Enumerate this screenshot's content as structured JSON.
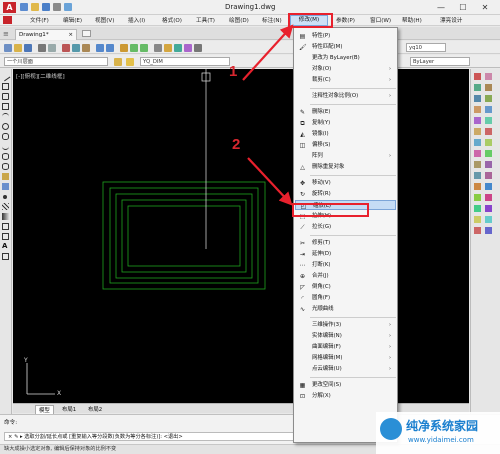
{
  "title_bar": {
    "logo_letter": "A",
    "title": "Drawing1.dwg",
    "minimize": "—",
    "maximize": "☐",
    "close": "✕"
  },
  "menu": {
    "items": [
      "文件(F)",
      "编辑(E)",
      "视图(V)",
      "插入(I)",
      "格式(O)",
      "工具(T)",
      "绘图(D)",
      "标注(N)",
      "修改(M)",
      "参数(P)",
      "窗口(W)",
      "帮助(H)",
      "漂亮设计"
    ]
  },
  "tabs": {
    "doc": "Drawing1*",
    "doc_close": "×"
  },
  "toolbar": {
    "layer_combo": "一个川层面",
    "style_combo": "YQ_DIM",
    "right_combo": "yq10",
    "bylayer": "ByLayer",
    "by_label": "ByLayer"
  },
  "viewport": {
    "label": "[-][俯视][二维线框]"
  },
  "layout_tabs": {
    "model": "模型",
    "layout1": "布局1",
    "layout2": "布局2"
  },
  "command": {
    "label": "命令:",
    "line": "× ✎ ▸ 选取分割/延长点或 [重复输入等分段数(负数为等分各标注)]: <退出>"
  },
  "status": {
    "text": "缺大成操小选定对象, 编辑后保持对象的比例不变"
  },
  "dropdown": {
    "items": [
      {
        "label": "特性(P)",
        "icon": "▤",
        "arrow": ""
      },
      {
        "label": "特性匹配(M)",
        "icon": "🖌",
        "arrow": ""
      },
      {
        "label": "更改为 ByLayer(B)",
        "icon": "",
        "arrow": ""
      },
      {
        "label": "对象(O)",
        "icon": "",
        "arrow": "›"
      },
      {
        "label": "裁剪(C)",
        "icon": "",
        "arrow": "›"
      },
      {
        "label": "注释性对象比例(O)",
        "icon": "",
        "arrow": "›"
      },
      {
        "label": "删除(E)",
        "icon": "✎",
        "arrow": ""
      },
      {
        "label": "复制(Y)",
        "icon": "⧉",
        "arrow": ""
      },
      {
        "label": "镜像(I)",
        "icon": "◭",
        "arrow": ""
      },
      {
        "label": "偏移(S)",
        "icon": "◫",
        "arrow": ""
      },
      {
        "label": "阵列",
        "icon": "",
        "arrow": "›"
      },
      {
        "label": "删除重复对象",
        "icon": "△",
        "arrow": ""
      },
      {
        "label": "移动(V)",
        "icon": "✥",
        "arrow": ""
      },
      {
        "label": "旋转(R)",
        "icon": "↻",
        "arrow": ""
      },
      {
        "label": "缩放(L)",
        "icon": "◰",
        "arrow": ""
      },
      {
        "label": "拉伸(H)",
        "icon": "⬚",
        "arrow": ""
      },
      {
        "label": "拉长(G)",
        "icon": "⟋",
        "arrow": ""
      },
      {
        "label": "修剪(T)",
        "icon": "✂",
        "arrow": ""
      },
      {
        "label": "延伸(D)",
        "icon": "⇥",
        "arrow": ""
      },
      {
        "label": "打断(K)",
        "icon": "⋯",
        "arrow": ""
      },
      {
        "label": "合并(J)",
        "icon": "⊕",
        "arrow": ""
      },
      {
        "label": "倒角(C)",
        "icon": "◸",
        "arrow": ""
      },
      {
        "label": "圆角(F)",
        "icon": "◜",
        "arrow": ""
      },
      {
        "label": "光顺曲线",
        "icon": "∿",
        "arrow": ""
      },
      {
        "label": "三维操作(3)",
        "icon": "",
        "arrow": "›"
      },
      {
        "label": "实体编辑(N)",
        "icon": "",
        "arrow": "›"
      },
      {
        "label": "曲面编辑(F)",
        "icon": "",
        "arrow": "›"
      },
      {
        "label": "网格编辑(M)",
        "icon": "",
        "arrow": "›"
      },
      {
        "label": "点云编辑(U)",
        "icon": "",
        "arrow": "›"
      },
      {
        "label": "更改空间(S)",
        "icon": "▦",
        "arrow": ""
      },
      {
        "label": "分解(X)",
        "icon": "⊡",
        "arrow": ""
      }
    ]
  },
  "annotations": {
    "step1": "1",
    "step2": "2"
  },
  "watermark": {
    "title": "纯净系统家园",
    "url": "www.yidaimei.com"
  },
  "colors": {
    "accent_red": "#e8212d",
    "highlight_blue": "#c5dcf5",
    "canvas": "#000000",
    "rect_green": "#1fa31f"
  }
}
